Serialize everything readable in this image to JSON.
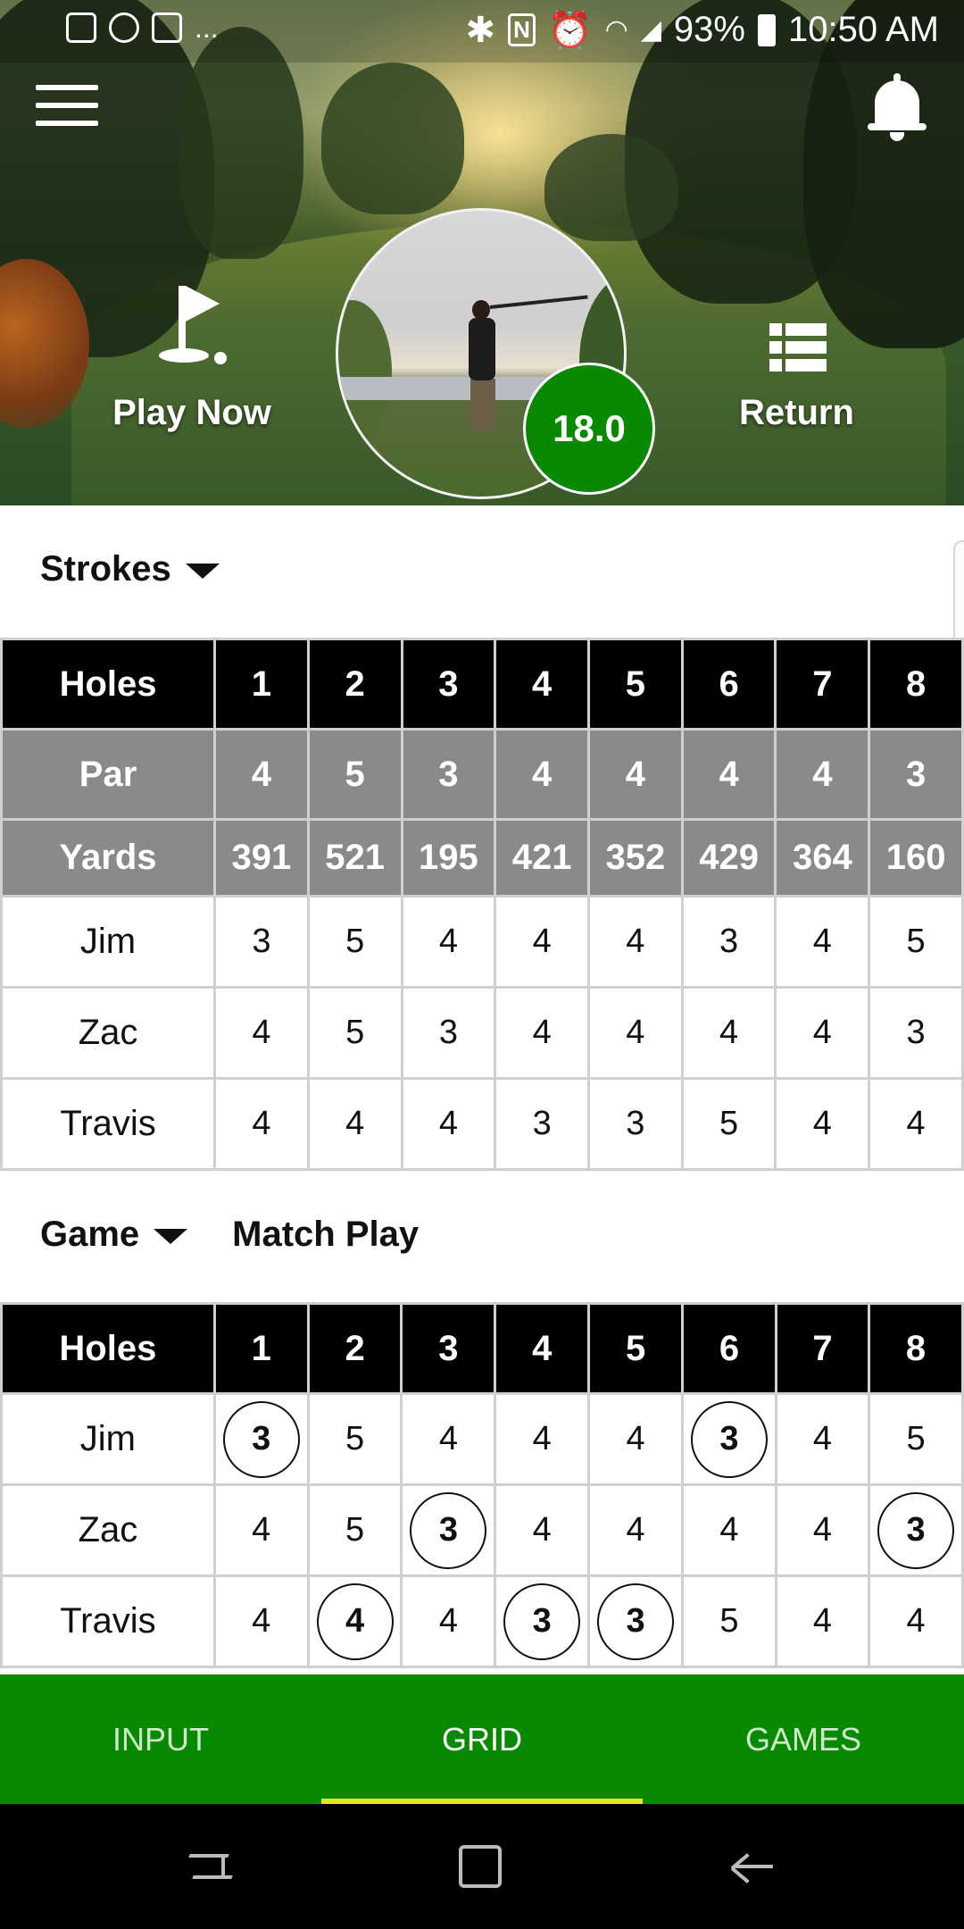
{
  "status_bar": {
    "battery": "93%",
    "time": "10:50 AM",
    "notification_icons": [
      "image-icon",
      "app-icon",
      "mail-icon"
    ],
    "more": "...",
    "system_icons": [
      "bluetooth-icon",
      "nfc-icon",
      "alarm-icon",
      "wifi-icon",
      "signal-icon",
      "battery-icon"
    ]
  },
  "header": {
    "play_now_label": "Play Now",
    "return_label": "Return",
    "handicap": "18.0",
    "accent_color": "#078a00"
  },
  "strokes": {
    "selector_label": "Strokes",
    "holes_header": "Holes",
    "holes": [
      "1",
      "2",
      "3",
      "4",
      "5",
      "6",
      "7",
      "8"
    ],
    "par_label": "Par",
    "par": [
      "4",
      "5",
      "3",
      "4",
      "4",
      "4",
      "4",
      "3"
    ],
    "yards_label": "Yards",
    "yards": [
      "391",
      "521",
      "195",
      "421",
      "352",
      "429",
      "364",
      "160"
    ],
    "players": [
      {
        "name": "Jim",
        "scores": [
          "3",
          "5",
          "4",
          "4",
          "4",
          "3",
          "4",
          "5"
        ]
      },
      {
        "name": "Zac",
        "scores": [
          "4",
          "5",
          "3",
          "4",
          "4",
          "4",
          "4",
          "3"
        ]
      },
      {
        "name": "Travis",
        "scores": [
          "4",
          "4",
          "4",
          "3",
          "3",
          "5",
          "4",
          "4"
        ]
      }
    ]
  },
  "game": {
    "selector_label": "Game",
    "mode": "Match Play",
    "holes_header": "Holes",
    "holes": [
      "1",
      "2",
      "3",
      "4",
      "5",
      "6",
      "7",
      "8"
    ],
    "players": [
      {
        "name": "Jim",
        "scores": [
          "3",
          "5",
          "4",
          "4",
          "4",
          "3",
          "4",
          "5"
        ],
        "winning_holes": [
          1,
          6
        ]
      },
      {
        "name": "Zac",
        "scores": [
          "4",
          "5",
          "3",
          "4",
          "4",
          "4",
          "4",
          "3"
        ],
        "winning_holes": [
          3,
          8
        ]
      },
      {
        "name": "Travis",
        "scores": [
          "4",
          "4",
          "4",
          "3",
          "3",
          "5",
          "4",
          "4"
        ],
        "winning_holes": [
          2,
          4,
          5
        ]
      }
    ]
  },
  "bottom_nav": {
    "tabs": [
      {
        "label": "INPUT",
        "active": false
      },
      {
        "label": "GRID",
        "active": true
      },
      {
        "label": "GAMES",
        "active": false
      }
    ],
    "active_color": "#e6e61a"
  }
}
